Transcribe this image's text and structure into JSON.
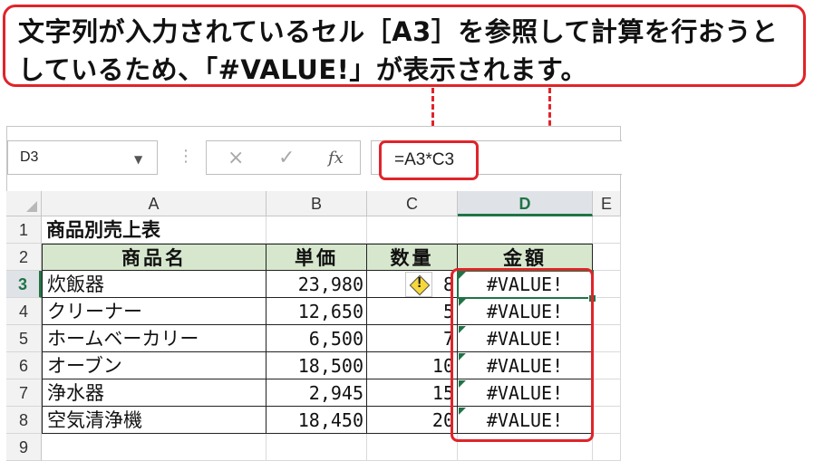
{
  "callout": {
    "line1": "文字列が入力されているセル［A3］を参照して計算を行おうと",
    "line2": "しているため、「#VALUE!」が表示されます。"
  },
  "formula_bar": {
    "name_box": "D3",
    "formula": "=A3*C3",
    "cancel_icon": "×",
    "enter_icon": "✓",
    "fx_label": "fx",
    "dropdown_icon": "▼",
    "separator": "⋮"
  },
  "columns": [
    "A",
    "B",
    "C",
    "D",
    "E"
  ],
  "rows": [
    "1",
    "2",
    "3",
    "4",
    "5",
    "6",
    "7",
    "8",
    "9"
  ],
  "sheet": {
    "title": "商品別売上表",
    "headers": [
      "商品名",
      "単価",
      "数量",
      "金額"
    ],
    "items": [
      {
        "name": "炊飯器",
        "price": "23,980",
        "qty": "8",
        "amount": "#VALUE!"
      },
      {
        "name": "クリーナー",
        "price": "12,650",
        "qty": "5",
        "amount": "#VALUE!"
      },
      {
        "name": "ホームベーカリー",
        "price": "6,500",
        "qty": "7",
        "amount": "#VALUE!"
      },
      {
        "name": "オーブン",
        "price": "18,500",
        "qty": "10",
        "amount": "#VALUE!"
      },
      {
        "name": "浄水器",
        "price": "2,945",
        "qty": "15",
        "amount": "#VALUE!"
      },
      {
        "name": "空気清浄機",
        "price": "18,450",
        "qty": "20",
        "amount": "#VALUE!"
      }
    ]
  },
  "warning_icon": "!",
  "colors": {
    "accent_red": "#e0242a",
    "excel_green": "#217346",
    "header_fill": "#d6e7cd"
  }
}
